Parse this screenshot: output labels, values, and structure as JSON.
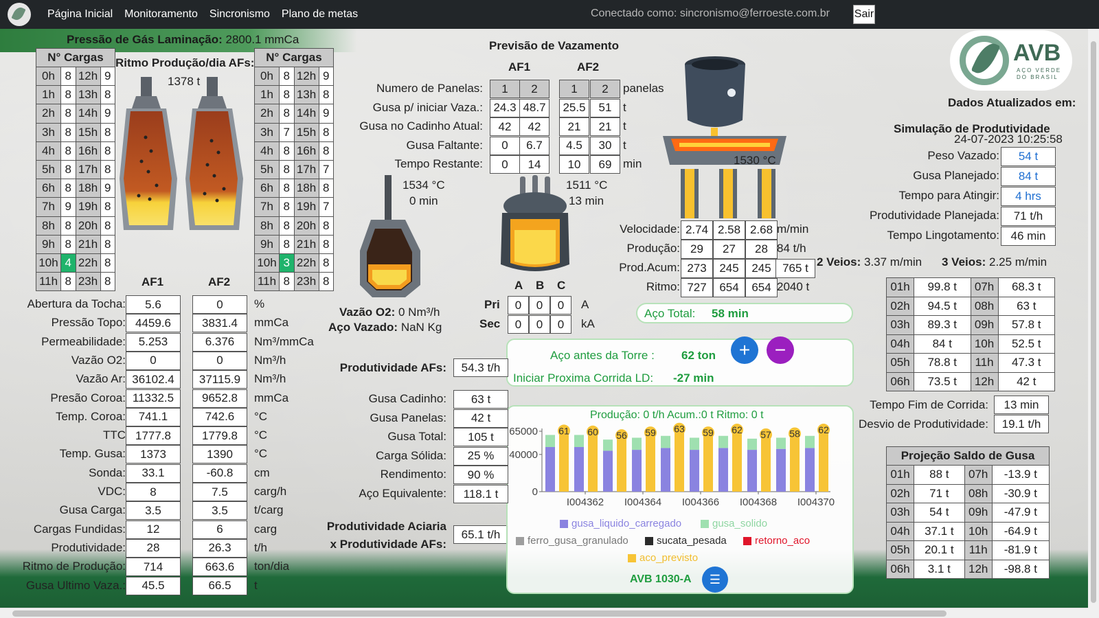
{
  "nav": {
    "items": [
      "Página Inicial",
      "Monitoramento",
      "Sincronismo",
      "Plano de metas"
    ],
    "connected": "Conectado como: sincronismo@ferroeste.com.br",
    "logout": "Sair"
  },
  "gas_pressure": {
    "label": "Pressão de Gás Laminação:",
    "value": "2800.1 mmCa"
  },
  "loads_header": "N° Cargas",
  "loads_left": [
    [
      "0h",
      "8",
      "12h",
      "9"
    ],
    [
      "1h",
      "8",
      "13h",
      "8"
    ],
    [
      "2h",
      "8",
      "14h",
      "9"
    ],
    [
      "3h",
      "8",
      "15h",
      "8"
    ],
    [
      "4h",
      "8",
      "16h",
      "8"
    ],
    [
      "5h",
      "8",
      "17h",
      "8"
    ],
    [
      "6h",
      "8",
      "18h",
      "9"
    ],
    [
      "7h",
      "9",
      "19h",
      "8"
    ],
    [
      "8h",
      "8",
      "20h",
      "8"
    ],
    [
      "9h",
      "8",
      "21h",
      "8"
    ],
    [
      "10h",
      "4",
      "22h",
      "8"
    ],
    [
      "11h",
      "8",
      "23h",
      "8"
    ]
  ],
  "loads_right": [
    [
      "0h",
      "8",
      "12h",
      "9"
    ],
    [
      "1h",
      "8",
      "13h",
      "8"
    ],
    [
      "2h",
      "8",
      "14h",
      "9"
    ],
    [
      "3h",
      "7",
      "15h",
      "8"
    ],
    [
      "4h",
      "8",
      "16h",
      "8"
    ],
    [
      "5h",
      "8",
      "17h",
      "7"
    ],
    [
      "6h",
      "8",
      "18h",
      "8"
    ],
    [
      "7h",
      "8",
      "19h",
      "7"
    ],
    [
      "8h",
      "8",
      "20h",
      "8"
    ],
    [
      "9h",
      "8",
      "21h",
      "8"
    ],
    [
      "10h",
      "3",
      "22h",
      "8"
    ],
    [
      "11h",
      "8",
      "23h",
      "8"
    ]
  ],
  "rhythm": {
    "title": "Ritmo Produção/dia AFs:",
    "value": "1378 t"
  },
  "af_headers": [
    "AF1",
    "AF2"
  ],
  "af_params": [
    {
      "label": "Abertura da Tocha:",
      "af1": "5.6",
      "af2": "0",
      "unit": "%"
    },
    {
      "label": "Pressão Topo:",
      "af1": "4459.6",
      "af2": "3831.4",
      "unit": "mmCa"
    },
    {
      "label": "Permeabilidade:",
      "af1": "5.253",
      "af2": "6.376",
      "unit": "Nm³/mmCa"
    },
    {
      "label": "Vazão O2:",
      "af1": "0",
      "af2": "0",
      "unit": "Nm³/h"
    },
    {
      "label": "Vazão Ar:",
      "af1": "36102.4",
      "af2": "37115.9",
      "unit": "Nm³/h"
    },
    {
      "label": "Presão Coroa:",
      "af1": "11332.5",
      "af2": "9652.8",
      "unit": "mmCa"
    },
    {
      "label": "Temp. Coroa:",
      "af1": "741.1",
      "af2": "742.6",
      "unit": "°C"
    },
    {
      "label": "TTC",
      "af1": "1777.8",
      "af2": "1779.8",
      "unit": "°C"
    },
    {
      "label": "Temp. Gusa:",
      "af1": "1373",
      "af2": "1390",
      "unit": "°C"
    },
    {
      "label": "Sonda:",
      "af1": "33.1",
      "af2": "-60.8",
      "unit": "cm"
    },
    {
      "label": "VDC:",
      "af1": "8",
      "af2": "7.5",
      "unit": "carg/h"
    },
    {
      "label": "Gusa Carga:",
      "af1": "3.5",
      "af2": "3.5",
      "unit": "t/carg"
    },
    {
      "label": "Cargas Fundidas:",
      "af1": "12",
      "af2": "6",
      "unit": "carg"
    },
    {
      "label": "Produtividade:",
      "af1": "28",
      "af2": "26.3",
      "unit": "t/h"
    },
    {
      "label": "Ritmo de Produção:",
      "af1": "714",
      "af2": "663.6",
      "unit": "ton/dia"
    },
    {
      "label": "Gusa Ultimo Vaza.:",
      "af1": "45.5",
      "af2": "66.5",
      "unit": "t"
    }
  ],
  "forecast": {
    "title": "Previsão de Vazamento",
    "af1": "AF1",
    "af2": "AF2",
    "rows": [
      {
        "label": "Numero de Panelas:",
        "v": [
          "1",
          "2",
          "1",
          "2"
        ],
        "unit": "panelas"
      },
      {
        "label": "Gusa p/ iniciar Vaza.:",
        "v": [
          "24.3",
          "48.7",
          "25.5",
          "51"
        ],
        "unit": "t"
      },
      {
        "label": "Gusa no Cadinho Atual:",
        "v": [
          "42",
          "42",
          "21",
          "21"
        ],
        "unit": "t"
      },
      {
        "label": "Gusa Faltante:",
        "v": [
          "0",
          "6.7",
          "4.5",
          "30"
        ],
        "unit": "t"
      },
      {
        "label": "Tempo Restante:",
        "v": [
          "0",
          "14",
          "10",
          "69"
        ],
        "unit": "min"
      }
    ]
  },
  "converter": {
    "temp": "1534 °C",
    "time": "0 min",
    "o2_label": "Vazão O2:",
    "o2_value": "0 Nm³/h",
    "steel_label": "Aço Vazado:",
    "steel_value": "NaN Kg"
  },
  "furnace": {
    "temp": "1511 °C",
    "time": "13 min",
    "cols": [
      "A",
      "B",
      "C"
    ],
    "pri_label": "Pri",
    "pri": [
      "0",
      "0",
      "0"
    ],
    "pri_unit": "A",
    "sec_label": "Sec",
    "sec": [
      "0",
      "0",
      "0"
    ],
    "sec_unit": "kA"
  },
  "ladle": {
    "temp": "1530 °C"
  },
  "casting": {
    "rows": [
      {
        "label": "Velocidade:",
        "v": [
          "2.74",
          "2.58",
          "2.68"
        ],
        "extra": "m/min",
        "extra_box": false
      },
      {
        "label": "Produção:",
        "v": [
          "29",
          "27",
          "28"
        ],
        "extra": "84 t/h",
        "extra_box": false
      },
      {
        "label": "Prod.Acum:",
        "v": [
          "273",
          "245",
          "245"
        ],
        "extra": "765 t",
        "extra_box": true
      },
      {
        "label": "Ritmo:",
        "v": [
          "727",
          "654",
          "654"
        ],
        "extra": "2040 t",
        "extra_box": false
      }
    ],
    "two_strands_label": "2 Veios:",
    "two_strands": "3.37 m/min",
    "three_strands_label": "3 Veios:",
    "three_strands": "2.25 m/min"
  },
  "steel_total": {
    "label": "Aço Total:",
    "value": "58 min"
  },
  "steel_before": {
    "label": "Aço antes da Torre :",
    "value": "62 ton",
    "next_label": "Iniciar Proxima Corrida LD:",
    "next_value": "-27 min"
  },
  "af_productivity": {
    "label": "Produtividade AFs:",
    "value": "54.3 t/h"
  },
  "summary": [
    {
      "label": "Gusa Cadinho:",
      "value": "63 t"
    },
    {
      "label": "Gusa Panelas:",
      "value": "42 t"
    },
    {
      "label": "Gusa Total:",
      "value": "105 t"
    },
    {
      "label": "Carga Sólida:",
      "value": "25 %"
    },
    {
      "label": "Rendimento:",
      "value": "90 %"
    },
    {
      "label": "Aço Equivalente:",
      "value": "118.1 t"
    }
  ],
  "steelshop_prod": {
    "label1": "Produtividade Aciaria",
    "label2": "x Produtividade AFs:",
    "value": "65.1 t/h"
  },
  "brand": {
    "name": "AVB",
    "sub1": "AÇO VERDE",
    "sub2": "DO BRASIL"
  },
  "updated": {
    "label": "Dados Atualizados em:",
    "value": "24-07-2023 10:25:58"
  },
  "simulation": {
    "title": "Simulação de Produtividade",
    "rows": [
      {
        "label": "Peso Vazado:",
        "value": "54 t",
        "blue": true
      },
      {
        "label": "Gusa Planejado:",
        "value": "84 t",
        "blue": true
      },
      {
        "label": "Tempo para Atingir:",
        "value": "4 hrs",
        "blue": true
      },
      {
        "label": "Produtividade Planejada:",
        "value": "71 t/h",
        "blue": false
      },
      {
        "label": "Tempo Lingotamento:",
        "value": "46 min",
        "blue": false
      }
    ]
  },
  "hourly": [
    [
      "01h",
      "99.8 t",
      "07h",
      "68.3 t"
    ],
    [
      "02h",
      "94.5 t",
      "08h",
      "63 t"
    ],
    [
      "03h",
      "89.3 t",
      "09h",
      "57.8 t"
    ],
    [
      "04h",
      "84 t",
      "10h",
      "52.5 t"
    ],
    [
      "05h",
      "78.8 t",
      "11h",
      "47.3 t"
    ],
    [
      "06h",
      "73.5 t",
      "12h",
      "42 t"
    ]
  ],
  "end_time": {
    "label": "Tempo Fim de Corrida:",
    "value": "13 min"
  },
  "deviation": {
    "label": "Desvio de Produtividade:",
    "value": "19.1 t/h"
  },
  "projection": {
    "title": "Projeção Saldo de Gusa",
    "rows": [
      [
        "01h",
        "88 t",
        "07h",
        "-13.9 t"
      ],
      [
        "02h",
        "71 t",
        "08h",
        "-30.9 t"
      ],
      [
        "03h",
        "54 t",
        "09h",
        "-47.9 t"
      ],
      [
        "04h",
        "37.1 t",
        "10h",
        "-64.9 t"
      ],
      [
        "05h",
        "20.1 t",
        "11h",
        "-81.9 t"
      ],
      [
        "06h",
        "3.1 t",
        "12h",
        "-98.8 t"
      ]
    ]
  },
  "chart_footer": "AVB 1030-A",
  "colors": {
    "green": "#1f9d3f",
    "blue_btn": "#1f74d4",
    "purple_btn": "#9b1fbf",
    "blue_val": "#1f6fd1"
  },
  "chart_data": {
    "type": "bar",
    "title": "Produção: 0 t/h Acum.:0 t Ritmo: 0 t",
    "ylim": [
      0,
      65000
    ],
    "yticks": [
      "65000",
      "40000",
      "0"
    ],
    "categories": [
      "I004361",
      "I004362",
      "I004363",
      "I004364",
      "I004365",
      "I004366",
      "I004367",
      "I004368",
      "I004369",
      "I004370"
    ],
    "xtick_labels": [
      "I004362",
      "I004364",
      "I004366",
      "I004368",
      "I004370"
    ],
    "series": [
      {
        "name": "gusa_liquido_carregado",
        "color": "#8a83e0",
        "values": [
          48000,
          48000,
          44000,
          45000,
          47000,
          45000,
          47000,
          45000,
          46000,
          47000
        ]
      },
      {
        "name": "gusa_solido",
        "color": "#9fe0b0",
        "values": [
          13000,
          13000,
          12000,
          13000,
          13000,
          13000,
          13000,
          12000,
          12000,
          13000
        ]
      },
      {
        "name": "ferro_gusa_granulado",
        "color": "#9e9e9e",
        "values": [
          0,
          0,
          0,
          0,
          0,
          0,
          0,
          0,
          0,
          0
        ]
      },
      {
        "name": "sucata_pesada",
        "color": "#2b2b2b",
        "values": [
          0,
          0,
          0,
          0,
          0,
          0,
          0,
          0,
          0,
          0
        ]
      },
      {
        "name": "retorno_aco",
        "color": "#e0152a",
        "values": [
          0,
          0,
          0,
          0,
          0,
          0,
          0,
          0,
          0,
          0
        ]
      },
      {
        "name": "aco_previsto",
        "color": "#f7c436",
        "values": [
          61000,
          60000,
          56000,
          59000,
          63000,
          59000,
          62000,
          57000,
          58000,
          62000
        ]
      }
    ],
    "bar_labels": [
      "61",
      "60",
      "56",
      "59",
      "63",
      "59",
      "62",
      "57",
      "58",
      "62"
    ]
  }
}
